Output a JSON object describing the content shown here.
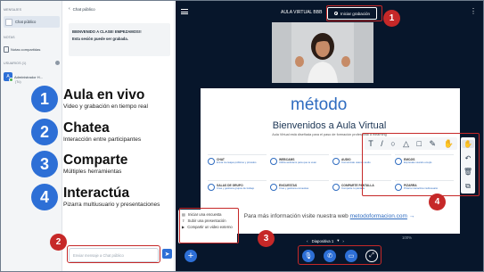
{
  "sidebar": {
    "messages_header": "MENSAJES",
    "public_chat": "Chat público",
    "notes_header": "NOTAS",
    "shared_notes": "Notas compartidas",
    "users_header": "USUARIOS (1)",
    "admin_name": "Administrador H...",
    "admin_initial": "A",
    "admin_tag": "(Tú)"
  },
  "chat": {
    "title": "Chat público",
    "welcome_line1": "BIENVENIDO A CLASE! EMPEZAMOS!!",
    "welcome_line2": "Esta sesión puede ser grabada.",
    "input_placeholder": "Enviar mensaje a Chat público"
  },
  "features": [
    {
      "num": "1",
      "title": "Aula en vivo",
      "sub": "Video y grabación en tiempo real"
    },
    {
      "num": "2",
      "title": "Chatea",
      "sub": "Interacción entre participantes"
    },
    {
      "num": "3",
      "title": "Comparte",
      "sub": "Múltiples herramientas"
    },
    {
      "num": "4",
      "title": "Interactúa",
      "sub": "Pizarra multiusuario y presentaciones"
    }
  ],
  "main": {
    "room_title": "AULA VIRTUAL BBB",
    "record_label": "Iniciar grabación"
  },
  "slide": {
    "logo": "método",
    "heading": "Bienvenidos a Aula Virtual",
    "desc": "Aula Virtual está diseñada para el paso de formación profesional a elearning",
    "cells": [
      {
        "title": "CHAT",
        "desc": "Envía mensajes públicos y privados"
      },
      {
        "title": "WEBCAMS",
        "desc": "Utiliza webcams para que te vean"
      },
      {
        "title": "AUDIO",
        "desc": "Comunícate usando audio"
      },
      {
        "title": "EMOJIS",
        "desc": "Expresate usando emojis"
      },
      {
        "title": "SALAS DE GRUPO",
        "desc": "Crea y gestiona grupos de trabajo"
      },
      {
        "title": "ENCUESTAS",
        "desc": "Crea y gestiona encuestas"
      },
      {
        "title": "COMPARTE PANTALLA",
        "desc": "Comparte tu pantalla"
      },
      {
        "title": "PIZARRA",
        "desc": "Pizarra interactiva multiusuario"
      }
    ],
    "more_text": "Para más información visite nuestra web",
    "more_link": "metodoformacion.com",
    "more_arrow": "→"
  },
  "slide_nav": {
    "label": "Diapositiva 1",
    "zoom": "100%"
  },
  "upload_menu": {
    "poll": "Iniciar una encuesta",
    "presentation": "Subir una presentación",
    "video": "Compartir un video externo"
  },
  "badges": [
    "1",
    "2",
    "3",
    "4"
  ],
  "colors": {
    "primary": "#2d6fd6",
    "dark_bg": "#07162b",
    "badge_red": "#c62828"
  }
}
